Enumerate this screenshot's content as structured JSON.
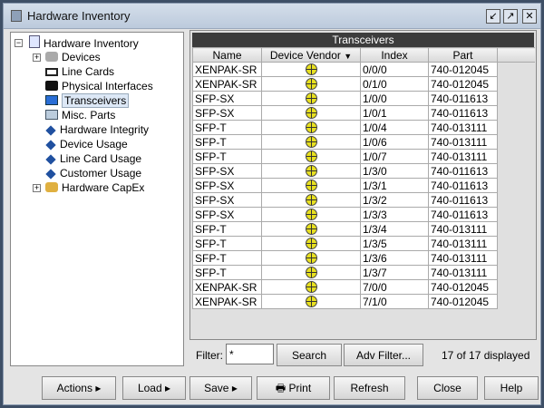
{
  "window": {
    "title": "Hardware Inventory"
  },
  "tree": [
    {
      "label": "Hardware Inventory",
      "icon": "document-icon",
      "expander": "−"
    },
    {
      "label": "Devices",
      "icon": "database-icon",
      "expander": "+"
    },
    {
      "label": "Line Cards",
      "icon": "line-card-icon"
    },
    {
      "label": "Physical Interfaces",
      "icon": "interface-icon"
    },
    {
      "label": "Transceivers",
      "icon": "transceiver-icon",
      "selected": true
    },
    {
      "label": "Misc. Parts",
      "icon": "laptop-icon"
    },
    {
      "label": "Hardware Integrity",
      "icon": "diamond-icon"
    },
    {
      "label": "Device Usage",
      "icon": "diamond-icon"
    },
    {
      "label": "Line Card Usage",
      "icon": "diamond-icon"
    },
    {
      "label": "Customer Usage",
      "icon": "diamond-icon"
    },
    {
      "label": "Hardware CapEx",
      "icon": "coins-icon",
      "expander": "+"
    }
  ],
  "table": {
    "title": "Transceivers",
    "columns": [
      "Name",
      "Device Vendor",
      "Index",
      "Part"
    ],
    "sort_indicator": "▼",
    "rows": [
      [
        "XENPAK-SR",
        "vendor-globe-icon",
        "0/0/0",
        "740-012045"
      ],
      [
        "XENPAK-SR",
        "vendor-globe-icon",
        "0/1/0",
        "740-012045"
      ],
      [
        "SFP-SX",
        "vendor-globe-icon",
        "1/0/0",
        "740-011613"
      ],
      [
        "SFP-SX",
        "vendor-globe-icon",
        "1/0/1",
        "740-011613"
      ],
      [
        "SFP-T",
        "vendor-globe-icon",
        "1/0/4",
        "740-013111"
      ],
      [
        "SFP-T",
        "vendor-globe-icon",
        "1/0/6",
        "740-013111"
      ],
      [
        "SFP-T",
        "vendor-globe-icon",
        "1/0/7",
        "740-013111"
      ],
      [
        "SFP-SX",
        "vendor-globe-icon",
        "1/3/0",
        "740-011613"
      ],
      [
        "SFP-SX",
        "vendor-globe-icon",
        "1/3/1",
        "740-011613"
      ],
      [
        "SFP-SX",
        "vendor-globe-icon",
        "1/3/2",
        "740-011613"
      ],
      [
        "SFP-SX",
        "vendor-globe-icon",
        "1/3/3",
        "740-011613"
      ],
      [
        "SFP-T",
        "vendor-globe-icon",
        "1/3/4",
        "740-013111"
      ],
      [
        "SFP-T",
        "vendor-globe-icon",
        "1/3/5",
        "740-013111"
      ],
      [
        "SFP-T",
        "vendor-globe-icon",
        "1/3/6",
        "740-013111"
      ],
      [
        "SFP-T",
        "vendor-globe-icon",
        "1/3/7",
        "740-013111"
      ],
      [
        "XENPAK-SR",
        "vendor-globe-icon",
        "7/0/0",
        "740-012045"
      ],
      [
        "XENPAK-SR",
        "vendor-globe-icon",
        "7/1/0",
        "740-012045"
      ]
    ]
  },
  "filter": {
    "label": "Filter:",
    "value": "*",
    "search": "Search",
    "adv": "Adv Filter...",
    "count": "17 of 17 displayed"
  },
  "buttons": {
    "actions": "Actions",
    "load": "Load",
    "save": "Save",
    "print": "Print",
    "refresh": "Refresh",
    "close": "Close",
    "help": "Help",
    "submenu_arrow": "▸"
  }
}
